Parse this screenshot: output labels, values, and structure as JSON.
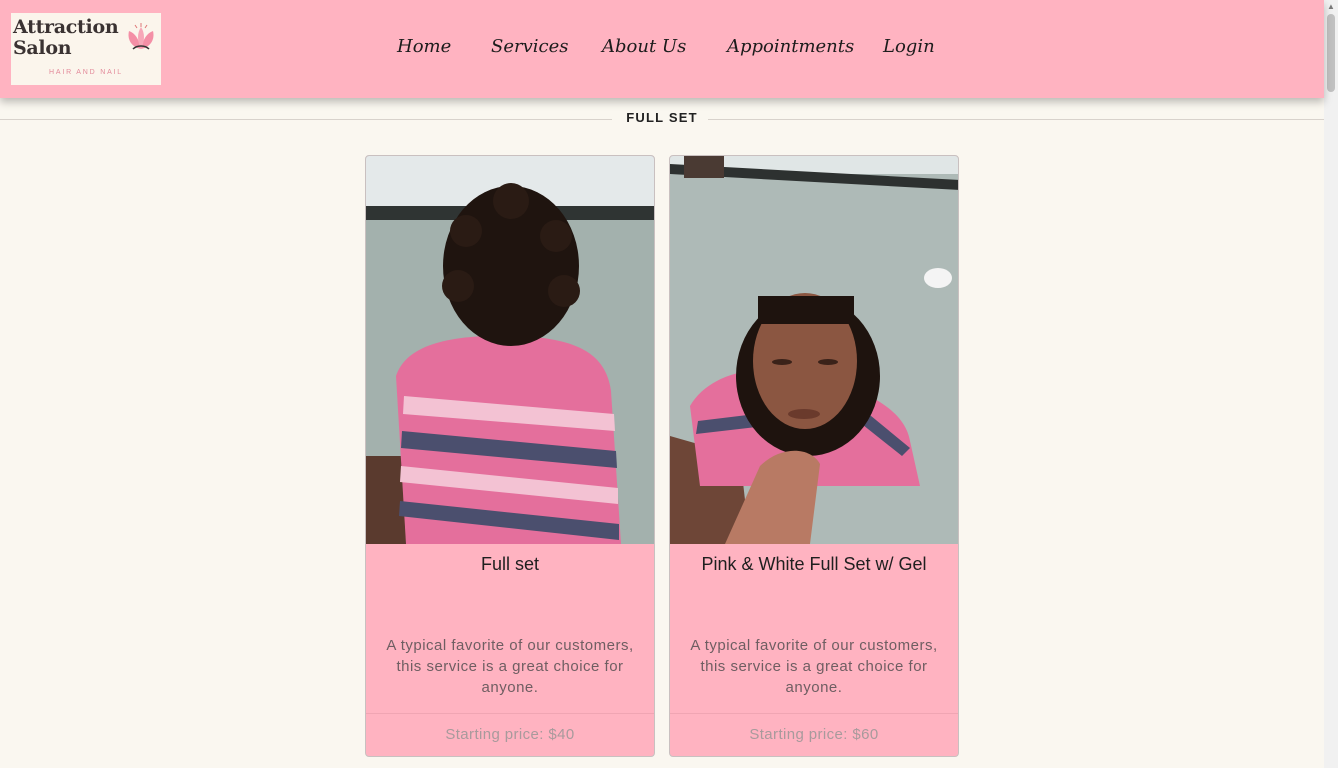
{
  "brand": {
    "name_line1": "Attraction",
    "name_line2": "Salon",
    "tagline": "HAIR AND NAIL",
    "accent_color": "#ffb3c1"
  },
  "nav": {
    "items": [
      {
        "label": "Home"
      },
      {
        "label": "Services"
      },
      {
        "label": "About Us"
      },
      {
        "label": "Appointments"
      },
      {
        "label": "Login"
      }
    ]
  },
  "section": {
    "title": "FULL SET"
  },
  "cards": [
    {
      "title": "Full set",
      "description": "A typical favorite of our customers, this service is a great choice for anyone.",
      "price": "Starting price: $40"
    },
    {
      "title": "Pink & White Full Set w/ Gel",
      "description": "A typical favorite of our customers, this service is a great choice for anyone.",
      "price": "Starting price: $60"
    }
  ],
  "icons": {
    "logo_flower": "lotus-flower-icon",
    "scroll_up": "scroll-up-arrow-icon"
  }
}
